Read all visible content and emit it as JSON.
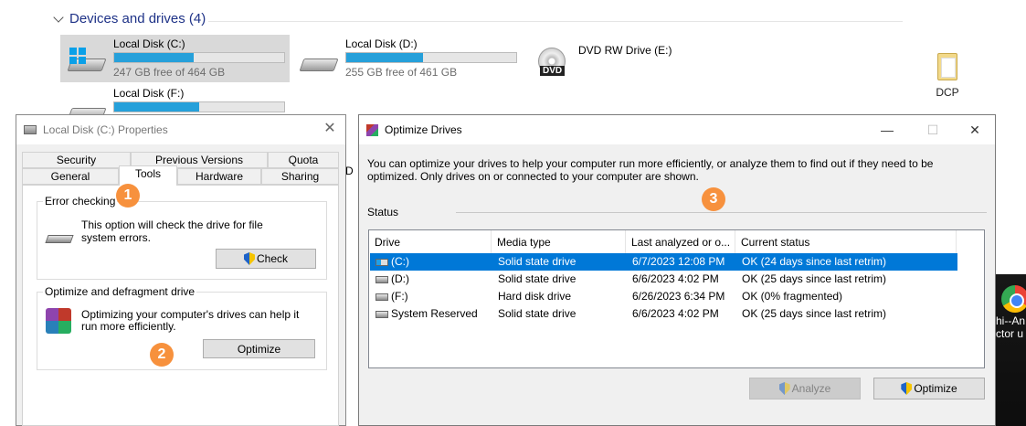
{
  "explorer": {
    "section_title": "Devices and drives (4)",
    "drives": [
      {
        "id": "c",
        "name": "Local Disk (C:)",
        "free": "247 GB free of 464 GB",
        "used_fraction": 0.47,
        "icon": "windows-drive-icon"
      },
      {
        "id": "d",
        "name": "Local Disk (D:)",
        "free": "255 GB free of 461 GB",
        "used_fraction": 0.45,
        "icon": "hard-drive-icon"
      },
      {
        "id": "e",
        "name": "DVD RW Drive (E:)",
        "icon": "dvd-drive-icon",
        "icon_text": "DVD"
      },
      {
        "id": "f",
        "name": "Local Disk (F:)",
        "used_fraction": 0.5,
        "icon": "hard-drive-icon"
      }
    ],
    "partial_text": "D"
  },
  "desktop": {
    "icons": [
      {
        "label": "DCP",
        "icon": "folder-icon"
      },
      {
        "label": "hi--An\nctor u",
        "icon": "chrome-icon"
      }
    ]
  },
  "properties": {
    "title": "Local Disk (C:) Properties",
    "tabs_row1": [
      "Security",
      "Previous Versions",
      "Quota"
    ],
    "tabs_row2": [
      "General",
      "Tools",
      "Hardware",
      "Sharing"
    ],
    "active_tab": "Tools",
    "error_checking": {
      "title": "Error checking",
      "text": "This option will check the drive for file system errors.",
      "button": "Check"
    },
    "optimize": {
      "title": "Optimize and defragment drive",
      "text": "Optimizing your computer's drives can help it run more efficiently.",
      "button": "Optimize"
    }
  },
  "optimize_drives": {
    "title": "Optimize Drives",
    "description": "You can optimize your drives to help your computer run more efficiently, or analyze them to find out if they need to be optimized. Only drives on or connected to your computer are shown.",
    "status_label": "Status",
    "columns": [
      "Drive",
      "Media type",
      "Last analyzed or o...",
      "Current status"
    ],
    "rows": [
      {
        "drive": "(C:)",
        "media": "Solid state drive",
        "last": "6/7/2023 12:08 PM",
        "status": "OK (24 days since last retrim)",
        "selected": true
      },
      {
        "drive": "(D:)",
        "media": "Solid state drive",
        "last": "6/6/2023 4:02 PM",
        "status": "OK (25 days since last retrim)",
        "selected": false
      },
      {
        "drive": "(F:)",
        "media": "Hard disk drive",
        "last": "6/26/2023 6:34 PM",
        "status": "OK (0% fragmented)",
        "selected": false
      },
      {
        "drive": "System Reserved",
        "media": "Solid state drive",
        "last": "6/6/2023 4:02 PM",
        "status": "OK (25 days since last retrim)",
        "selected": false
      }
    ],
    "analyze_button": "Analyze",
    "optimize_button": "Optimize",
    "window_controls": {
      "minimize": "—",
      "maximize": "☐",
      "close": "✕"
    }
  },
  "badges": [
    "1",
    "2",
    "3"
  ],
  "colors": {
    "accent": "#0078d7",
    "bar_fill": "#26a0da",
    "badge": "#f7913d",
    "header_blue": "#1e3287"
  }
}
